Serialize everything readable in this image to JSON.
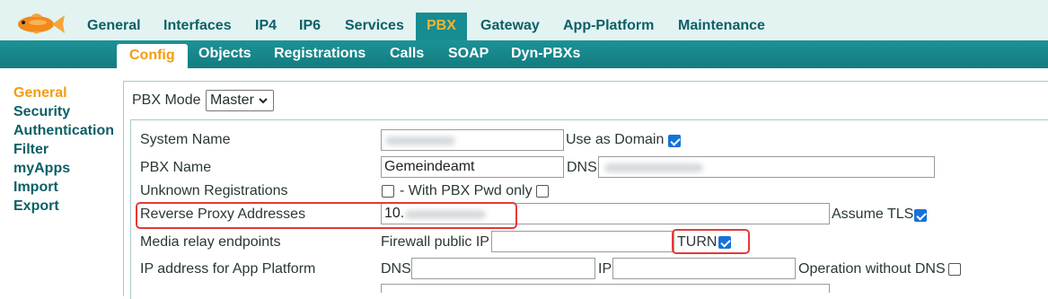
{
  "main_nav": [
    {
      "label": "General",
      "active": false
    },
    {
      "label": "Interfaces",
      "active": false
    },
    {
      "label": "IP4",
      "active": false
    },
    {
      "label": "IP6",
      "active": false
    },
    {
      "label": "Services",
      "active": false
    },
    {
      "label": "PBX",
      "active": true
    },
    {
      "label": "Gateway",
      "active": false
    },
    {
      "label": "App-Platform",
      "active": false
    },
    {
      "label": "Maintenance",
      "active": false
    }
  ],
  "sub_nav": [
    {
      "label": "Config",
      "active": true
    },
    {
      "label": "Objects",
      "active": false
    },
    {
      "label": "Registrations",
      "active": false
    },
    {
      "label": "Calls",
      "active": false
    },
    {
      "label": "SOAP",
      "active": false
    },
    {
      "label": "Dyn-PBXs",
      "active": false
    }
  ],
  "side_menu": [
    {
      "label": "General",
      "active": true
    },
    {
      "label": "Security",
      "active": false
    },
    {
      "label": "Authentication",
      "active": false
    },
    {
      "label": "Filter",
      "active": false
    },
    {
      "label": "myApps",
      "active": false
    },
    {
      "label": "Import",
      "active": false
    },
    {
      "label": "Export",
      "active": false
    }
  ],
  "form": {
    "pbx_mode_label": "PBX Mode",
    "pbx_mode_value": "Master",
    "system_name_label": "System Name",
    "use_as_domain_label": "Use as Domain",
    "use_as_domain_checked": true,
    "pbx_name_label": "PBX Name",
    "pbx_name_value": "Gemeindeamt",
    "dns_label": "DNS",
    "unknown_reg_label": "Unknown Registrations",
    "with_pbx_pwd_label": "- With PBX Pwd only",
    "unknown_reg_checked": false,
    "with_pbx_pwd_checked": false,
    "reverse_proxy_label": "Reverse Proxy Addresses",
    "reverse_proxy_value": "10.",
    "assume_tls_label": "Assume TLS",
    "assume_tls_checked": true,
    "media_relay_label": "Media relay endpoints",
    "firewall_ip_label": "Firewall public IP",
    "turn_label": "TURN",
    "turn_checked": true,
    "app_platform_ip_label": "IP address for App Platform",
    "app_dns_label": "DNS",
    "app_ip_label": "IP",
    "op_without_dns_label": "Operation without DNS",
    "op_without_dns_checked": false
  },
  "colors": {
    "accent": "#178c91",
    "active_text": "#f39c12",
    "nav_text": "#0d5f66",
    "highlight": "#e53935",
    "checkbox": "#1673d6"
  }
}
